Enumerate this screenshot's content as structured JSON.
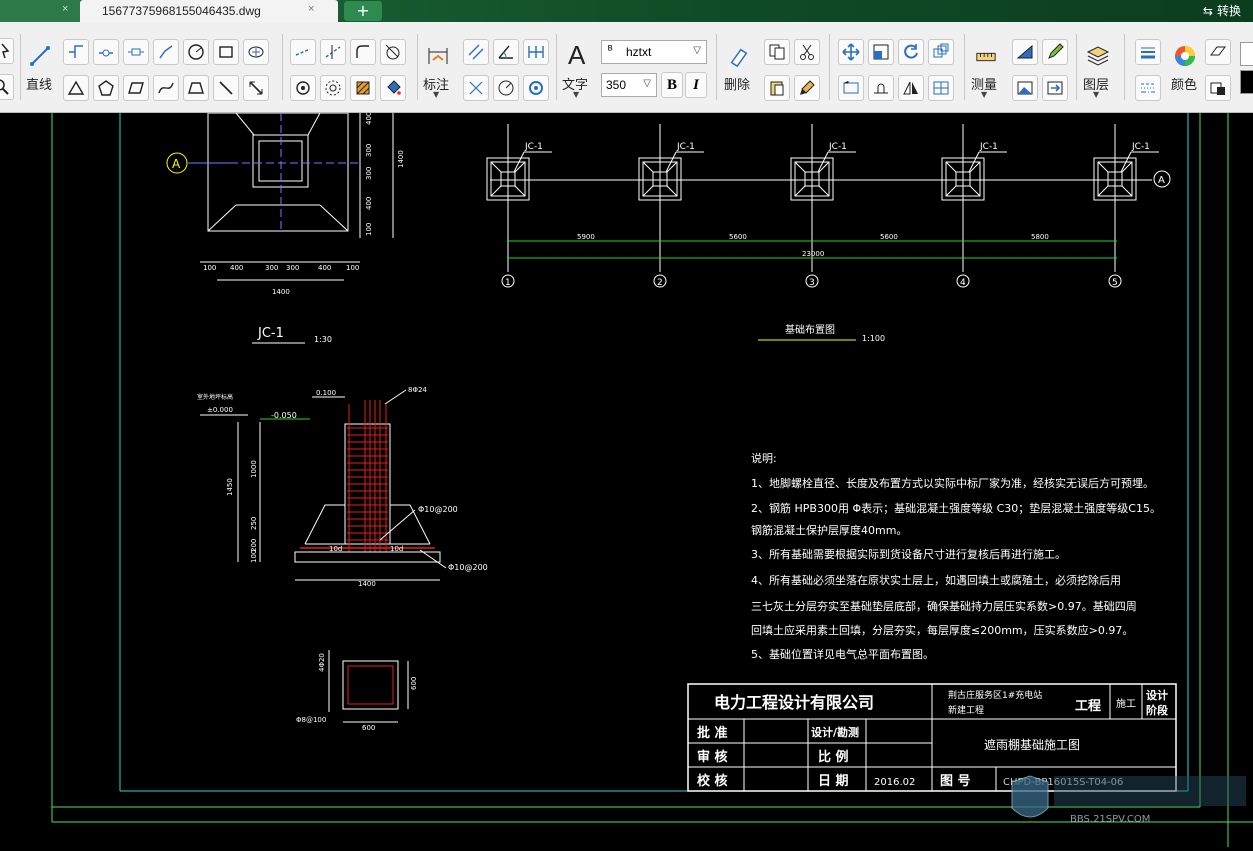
{
  "tabs": {
    "active_file": "15677375968155046435.dwg",
    "close_glyph": "×",
    "add_glyph": "+",
    "convert_label": "转换"
  },
  "toolbar": {
    "line_label": "直线",
    "dimension_label": "标注",
    "text_label": "文字",
    "font_value": "hztxt",
    "size_value": "350",
    "bold_label": "B",
    "italic_label": "I",
    "delete_label": "删除",
    "measure_label": "测量",
    "layer_label": "图层",
    "color_label": "颜色"
  },
  "drawing": {
    "axis_a": "A",
    "jc1_dims_v": [
      "400",
      "300",
      "300",
      "400",
      "100",
      "100",
      "1400"
    ],
    "jc1_dims_h": [
      "100",
      "400",
      "300",
      "300",
      "400",
      "100"
    ],
    "jc1_total": "1400",
    "jc1_title": "JC-1",
    "jc1_scale": "1:30",
    "foundation_label": "JC-1",
    "plan_spans": [
      "5900",
      "5600",
      "5600",
      "5800"
    ],
    "plan_total": "23000",
    "axis_numbers": [
      "1",
      "2",
      "3",
      "4",
      "5"
    ],
    "plan_title": "基础布置图",
    "plan_scale": "1:100",
    "section": {
      "ground_label": "室外地坪标高",
      "ground_elev": "±0.000",
      "elev_top": "0.100",
      "elev_bottom": "-0.050",
      "rebar_main": "8Φ24",
      "stirrup_top": "Φ10@200",
      "stirrup_bottom": "Φ10@200",
      "dims_v": [
        "1000",
        "1450",
        "250",
        "200",
        "100"
      ],
      "ten_d_left": "10d",
      "ten_d_right": "10d",
      "base_width": "1400"
    },
    "column": {
      "rebar": "4Φ20",
      "stirrup": "Φ8@100",
      "width": "600",
      "height": "600"
    },
    "notes": {
      "title": "说明:",
      "lines": [
        "1、地脚螺栓直径、长度及布置方式以实际中标厂家为准，经核实无误后方可预埋。",
        "2、钢筋 HPB300用 Φ表示；基础混凝土强度等级 C30；垫层混凝土强度等级C15。",
        "钢筋混凝土保护层厚度40mm。",
        "3、所有基础需要根据实际到货设备尺寸进行复核后再进行施工。",
        "4、所有基础必须坐落在原状实土层上，如遇回填土或腐殖土，必须挖除后用",
        "三七灰土分层夯实至基础垫层底部，确保基础持力层压实系数>0.97。基础四周",
        "回填土应采用素土回填，分层夯实，每层厚度≤200mm，压实系数应>0.97。",
        "5、基础位置详见电气总平面布置图。"
      ]
    },
    "title_block": {
      "company": "电力工程设计有限公司",
      "project_line1": "荆古庄服务区1#充电站",
      "project_line2": "新建工程",
      "project_suffix": "工程",
      "stage1": "施工",
      "stage2_a": "设计",
      "stage2_b": "阶段",
      "approve": "批 准",
      "review": "审 核",
      "check": "校 核",
      "design": "设计/勘测",
      "scale": "比 例",
      "date_label": "日 期",
      "date_value": "2016.02",
      "drawing_name": "遮雨棚基础施工图",
      "drawing_no_label": "图 号",
      "drawing_no": "CHPD-BP16015S-T04-06"
    },
    "watermark": "BBS.21SPV.COM"
  }
}
